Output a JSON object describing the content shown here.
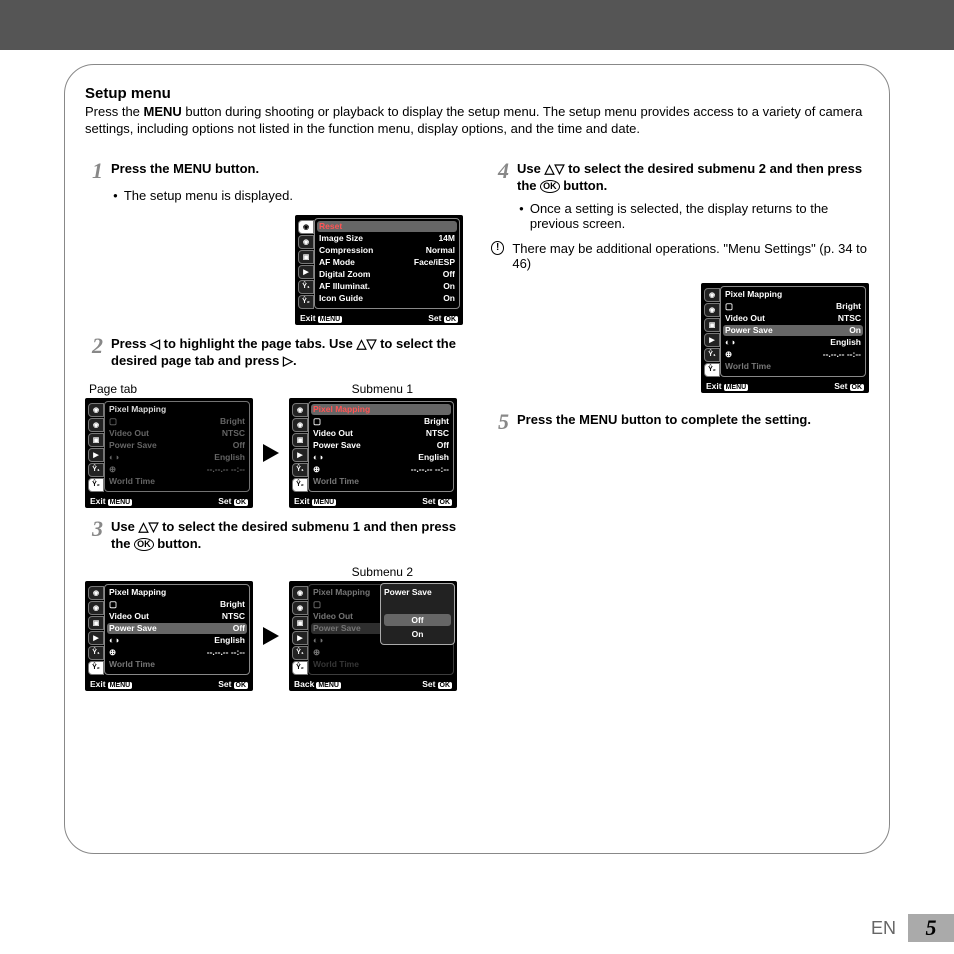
{
  "header": {
    "title": "Setup menu",
    "intro_a": "Press the ",
    "intro_menu": "MENU",
    "intro_b": " button during shooting or playback to display the setup menu. The setup menu provides access to a variety of camera settings, including options not listed in the function menu, display options, and the time and date."
  },
  "steps": {
    "s1": {
      "num": "1",
      "text_a": "Press the ",
      "menu": "MENU",
      "text_b": " button.",
      "bullet": "The setup menu is displayed."
    },
    "s2": {
      "num": "2",
      "text": "Press ◁ to highlight the page tabs. Use △▽ to select the desired page tab and press ▷.",
      "label_left": "Page tab",
      "label_right": "Submenu 1"
    },
    "s3": {
      "num": "3",
      "text_a": "Use △▽ to select the desired submenu 1 and then press the ",
      "ok": "OK",
      "text_b": " button.",
      "label_right": "Submenu 2"
    },
    "s4": {
      "num": "4",
      "text_a": "Use △▽ to select the desired submenu 2 and then press the ",
      "ok": "OK",
      "text_b": " button.",
      "bullet": "Once a setting is selected, the display returns to the previous screen.",
      "note": "There may be additional operations. \"Menu Settings\" (p. 34 to 46)"
    },
    "s5": {
      "num": "5",
      "text_a": "Press the ",
      "menu": "MENU",
      "text_b": " button to complete the setting."
    }
  },
  "screens": {
    "camera_menu": {
      "reset": "Reset",
      "rows": [
        {
          "l": "Image Size",
          "v": "14M"
        },
        {
          "l": "Compression",
          "v": "Normal"
        },
        {
          "l": "AF Mode",
          "v": "Face/iESP"
        },
        {
          "l": "Digital Zoom",
          "v": "Off"
        },
        {
          "l": "AF Illuminat.",
          "v": "On"
        },
        {
          "l": "Icon Guide",
          "v": "On"
        }
      ],
      "exit": "Exit",
      "set": "Set",
      "menu_tag": "MENU",
      "ok_tag": "OK"
    },
    "setup_menu": {
      "pixmap": "Pixel Mapping",
      "rows": [
        {
          "l": "",
          "v": "Bright"
        },
        {
          "l": "Video Out",
          "v": "NTSC"
        },
        {
          "l": "Power Save",
          "v": "Off"
        },
        {
          "l": "",
          "v": "English"
        },
        {
          "l": "",
          "v": "--.--.-- --:--"
        }
      ],
      "world": "World Time",
      "exit": "Exit",
      "back": "Back",
      "set": "Set",
      "menu_tag": "MENU",
      "ok_tag": "OK"
    },
    "setup_sel": {
      "power_on": "On"
    },
    "popup": {
      "title": "Power Save",
      "off": "Off",
      "on": "On"
    }
  },
  "footer": {
    "lang": "EN",
    "page": "5"
  }
}
